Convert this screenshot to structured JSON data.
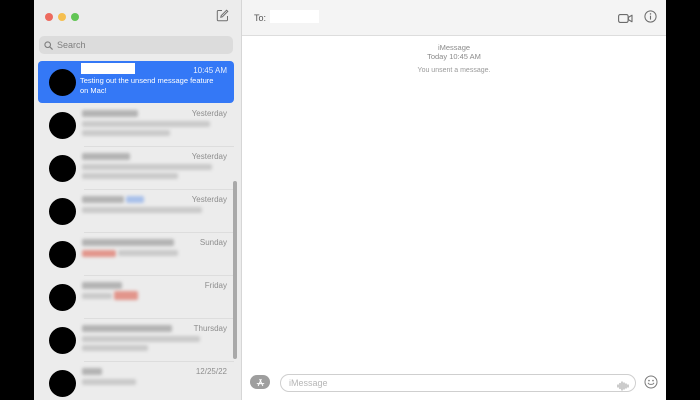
{
  "sidebar": {
    "search_placeholder": "Search",
    "conversations": [
      {
        "time": "10:45 AM",
        "preview": "Testing out the unsend message feature on Mac!",
        "selected": true
      },
      {
        "time": "Yesterday"
      },
      {
        "time": "Yesterday"
      },
      {
        "time": "Yesterday"
      },
      {
        "time": "Sunday"
      },
      {
        "time": "Friday"
      },
      {
        "time": "Thursday"
      },
      {
        "time": "12/25/22"
      }
    ]
  },
  "main": {
    "to_label": "To:",
    "thread": {
      "service": "iMessage",
      "timestamp": "Today 10:45 AM",
      "unsent_notice": "You unsent a message."
    },
    "composer": {
      "placeholder": "iMessage"
    }
  },
  "colors": {
    "selection": "#3478f6",
    "close": "#ed6a5e",
    "minimize": "#f5bf4f",
    "zoom": "#61c554"
  },
  "icons": [
    "compose-icon",
    "search-icon",
    "video-call-icon",
    "info-icon",
    "app-store-icon",
    "audio-waveform-icon",
    "emoji-icon"
  ]
}
